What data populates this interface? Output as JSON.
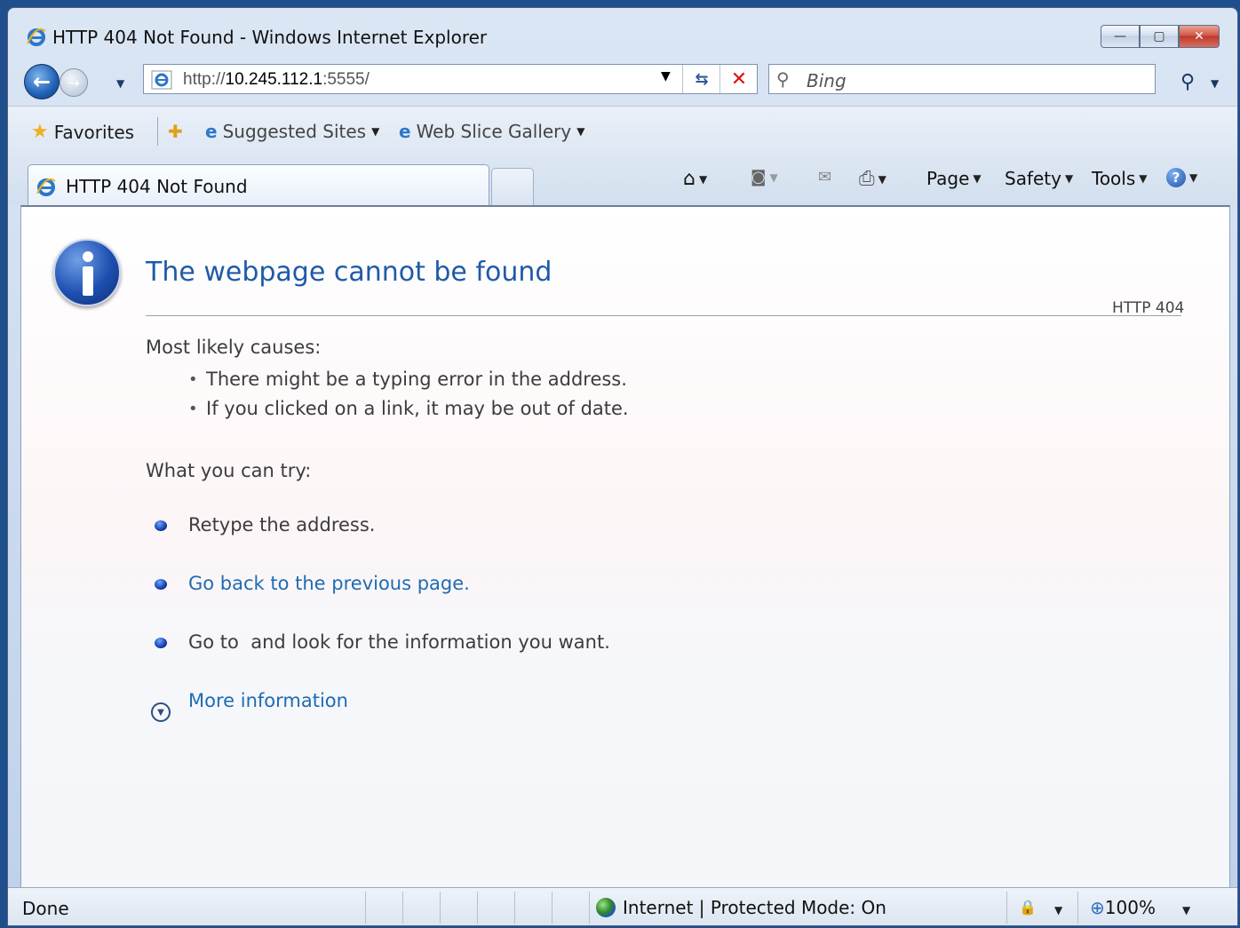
{
  "window": {
    "title": "HTTP 404 Not Found - Windows Internet Explorer"
  },
  "caption_buttons": {
    "minimize": "—",
    "maximize": "▢",
    "close": "✕"
  },
  "address": {
    "prefix": "http://",
    "host": "10.245.112.1",
    "suffix": ":5555/"
  },
  "search": {
    "placeholder": "Bing"
  },
  "favorites_bar": {
    "favorites_label": "Favorites",
    "suggested_sites": "Suggested Sites",
    "web_slice_gallery": "Web Slice Gallery"
  },
  "tab": {
    "title": "HTTP 404 Not Found"
  },
  "command_bar": {
    "page": "Page",
    "safety": "Safety",
    "tools": "Tools"
  },
  "page": {
    "heading": "The webpage cannot be found",
    "http_code": "HTTP 404",
    "causes_title": "Most likely causes:",
    "causes": [
      "There might be a typing error in the address.",
      "If you clicked on a link, it may be out of date."
    ],
    "try_title": "What you can try:",
    "try_items": [
      "Retype the address.",
      "Go back to the previous page.",
      "Go to  and look for the information you want."
    ],
    "more_info": "More information"
  },
  "status": {
    "text": "Done",
    "zone": "Internet | Protected Mode: On",
    "zoom": "100%"
  }
}
